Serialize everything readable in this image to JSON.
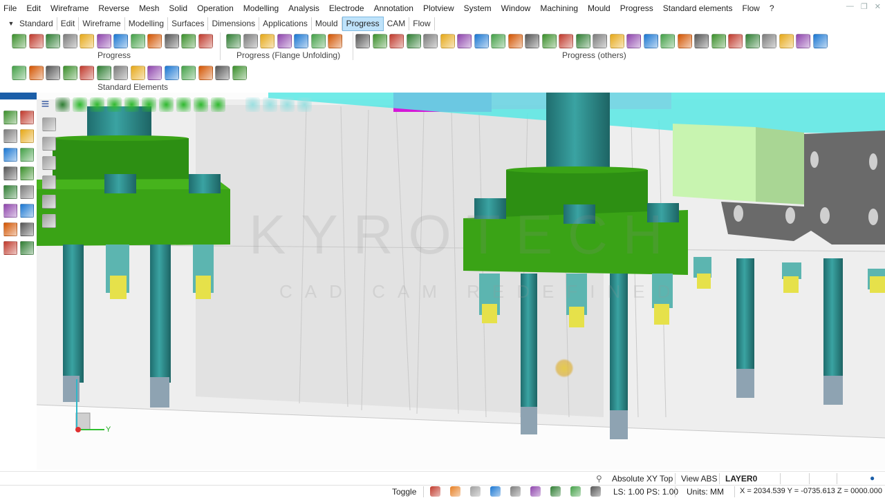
{
  "menu": [
    "File",
    "Edit",
    "Wireframe",
    "Reverse",
    "Mesh",
    "Solid",
    "Operation",
    "Modelling",
    "Analysis",
    "Electrode",
    "Annotation",
    "Plotview",
    "System",
    "Window",
    "Machining",
    "Mould",
    "Progress",
    "Standard elements",
    "Flow",
    "?"
  ],
  "ribbon": {
    "tabs": [
      "Standard",
      "Edit",
      "Wireframe",
      "Modelling",
      "Surfaces",
      "Dimensions",
      "Applications",
      "Mould",
      "Progress",
      "CAM",
      "Flow"
    ],
    "active_tab": "Progress",
    "groups": {
      "progress": "Progress",
      "flange": "Progress (Flange Unfolding)",
      "others": "Progress (others)",
      "standard_elements": "Standard Elements"
    }
  },
  "watermark": {
    "main": "KYROTECH",
    "sub": "CAD CAM REDEFINED"
  },
  "axis": {
    "y_label": "Y"
  },
  "status": {
    "view_mode": "Absolute XY Top",
    "view_abs": "View ABS",
    "layer": "LAYER0",
    "toggle": "Toggle",
    "scale": "LS: 1.00 PS: 1.00",
    "units": "Units: MM",
    "coords": "X = 2034.539 Y = -0735.613 Z = 0000.000"
  },
  "colors": {
    "accent_tab": "#bfe3fb",
    "part_green": "#3aa014",
    "bolt_teal": "#2b8e8c",
    "slug_yellow": "#e6e14a",
    "magenta_block": "#d419d8",
    "cyan_plate": "#58e7e4"
  },
  "icons": {
    "ribbon": "assorted-cad-icons",
    "left_panel": "assorted-cad-icons",
    "view_toolbar": [
      "hamburger-icon",
      "fit-icon",
      "pan-icon",
      "rotate-icon",
      "cube-iso-icon",
      "cube-front-icon",
      "cube-top-icon",
      "cube-right-icon",
      "cube-left-icon",
      "cube-back-icon",
      "cube-solid-icon",
      "magnet-icon",
      "zoom-icon",
      "zoom-out-icon",
      "zoom-area-icon",
      "zoom-all-icon"
    ]
  }
}
